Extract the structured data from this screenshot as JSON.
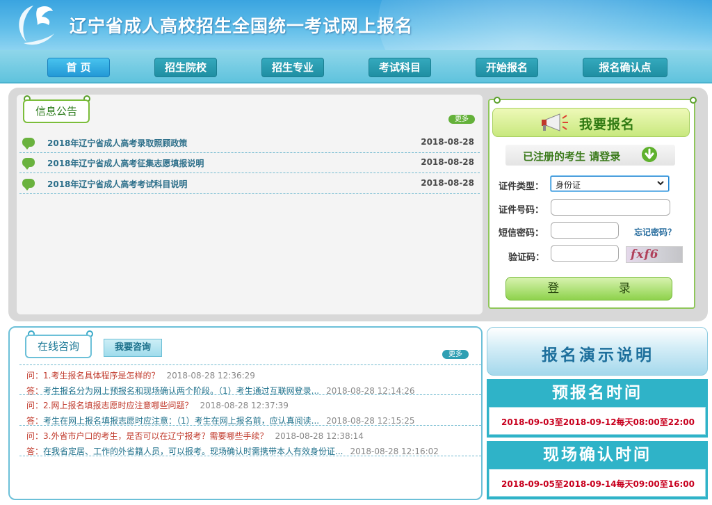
{
  "header": {
    "title": "辽宁省成人高校招生全国统一考试网上报名"
  },
  "nav": {
    "items": [
      {
        "label": "首  页",
        "active": true
      },
      {
        "label": "招生院校",
        "active": false
      },
      {
        "label": "招生专业",
        "active": false
      },
      {
        "label": "考试科目",
        "active": false
      },
      {
        "label": "开始报名",
        "active": false
      },
      {
        "label": "报名确认点",
        "active": false
      }
    ]
  },
  "notice": {
    "label": "信息公告",
    "more": "更多",
    "items": [
      {
        "title": "2018年辽宁省成人高考录取照顾政策",
        "date": "2018-08-28"
      },
      {
        "title": "2018年辽宁省成人高考征集志愿填报说明",
        "date": "2018-08-28"
      },
      {
        "title": "2018年辽宁省成人高考考试科目说明",
        "date": "2018-08-28"
      }
    ]
  },
  "login": {
    "title": "我要报名",
    "subtitle": "已注册的考生  请登录",
    "id_type_label": "证件类型：",
    "id_type_value": "身份证",
    "id_number_label": "证件号码：",
    "sms_label": "短信密码：",
    "forgot": "忘记密码？",
    "captcha_label": "验证码：",
    "captcha_code": "fxf6",
    "submit": "登 录"
  },
  "consult": {
    "label": "在线咨询",
    "ask_button": "我要咨询",
    "more": "更多",
    "items": [
      {
        "q_label": "问：",
        "question": "1.考生报名具体程序是怎样的？",
        "q_time": "2018-08-28 12:36:29",
        "a_label": "答：",
        "answer": "考生报名分为网上预报名和现场确认两个阶段。（1）考生通过互联网登录...",
        "a_time": "2018-08-28 12:14:26"
      },
      {
        "q_label": "问：",
        "question": "2.网上报名填报志愿时应注意哪些问题？",
        "q_time": "2018-08-28 12:37:39",
        "a_label": "答：",
        "answer": "考生在网上报名填报志愿时应注意：（1）考生在网上报名前，应认真阅读...",
        "a_time": "2018-08-28 12:15:25"
      },
      {
        "q_label": "问：",
        "question": "3.外省市户口的考生，是否可以在辽宁报考？需要哪些手续？",
        "q_time": "2018-08-28 12:38:14",
        "a_label": "答：",
        "answer": "在我省定居、工作的外省籍人员，可以报考。现场确认时需携带本人有效身份证...",
        "a_time": "2018-08-28 12:16:02"
      }
    ]
  },
  "demo": {
    "label": "报名演示说明"
  },
  "pre_registration": {
    "title": "预报名时间",
    "value": "2018-09-03至2018-09-12每天08:00至22:00"
  },
  "onsite_confirm": {
    "title": "现场确认时间",
    "value": "2018-09-05至2018-09-14每天09:00至16:00"
  },
  "colors": {
    "header_blue": "#3aa4e0",
    "nav_teal": "#1f8fa3",
    "green_accent": "#6ab23e",
    "date_red": "#c8001e"
  }
}
